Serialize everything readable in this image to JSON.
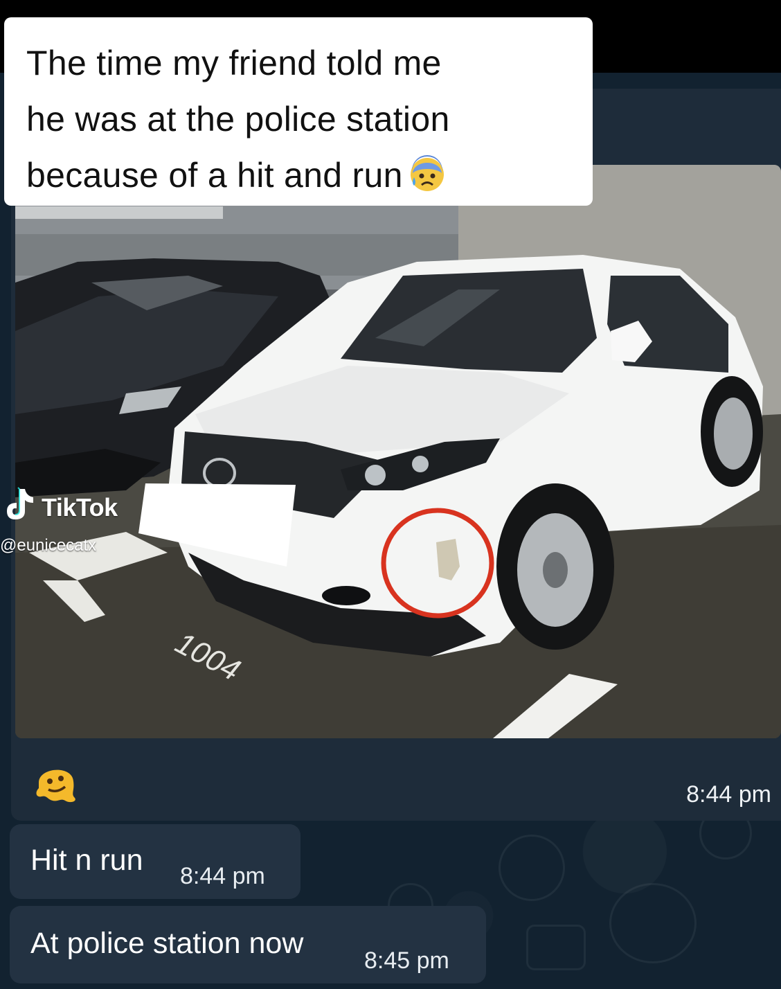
{
  "caption": {
    "lines": [
      "The time my friend told me",
      "he was at the police station",
      "because of a hit and run"
    ],
    "emoji": "anxious-face-with-sweat"
  },
  "watermark": {
    "app_name": "TikTok",
    "handle": "@eunicecatx"
  },
  "photo_message": {
    "image": "white-car-parked-with-damaged-bumper",
    "floor_marking": "1004",
    "reaction_emoji": "melting-face",
    "time": "8:44 pm"
  },
  "messages": [
    {
      "text": "Hit n run",
      "time": "8:44 pm"
    },
    {
      "text": "At police station now",
      "time": "8:45 pm"
    }
  ],
  "colors": {
    "chat_background": "#122230",
    "bubble": "#233242",
    "highlight_circle": "#d8331f"
  }
}
